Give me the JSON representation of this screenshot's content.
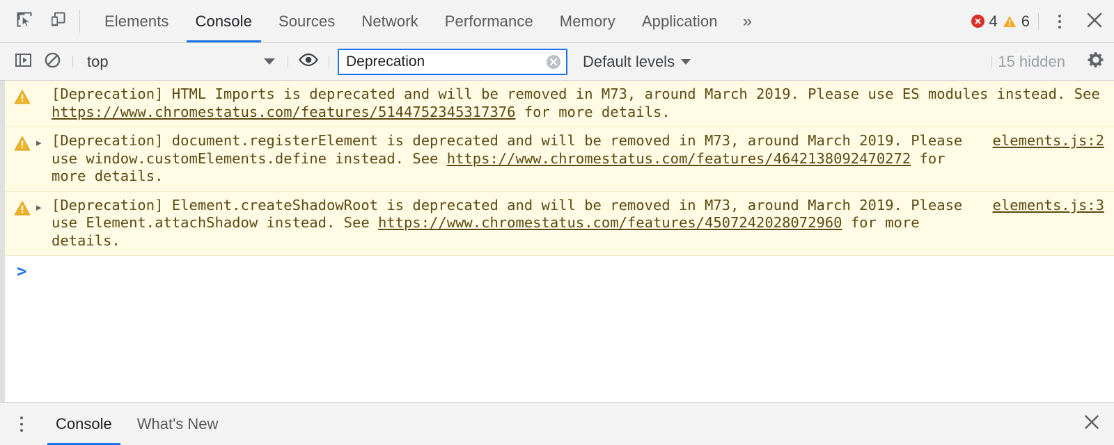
{
  "toolbar": {
    "inspect_icon": "inspect-element-icon",
    "device_icon": "device-toolbar-icon",
    "tabs": [
      {
        "label": "Elements",
        "selected": false
      },
      {
        "label": "Console",
        "selected": true
      },
      {
        "label": "Sources",
        "selected": false
      },
      {
        "label": "Network",
        "selected": false
      },
      {
        "label": "Performance",
        "selected": false
      },
      {
        "label": "Memory",
        "selected": false
      },
      {
        "label": "Application",
        "selected": false
      }
    ],
    "more_tabs_label": "»",
    "error_count": "4",
    "warning_count": "6",
    "error_color": "#d93025",
    "warning_color": "#f9a825",
    "accent_color": "#1a73e8",
    "menu_icon": "kebab-menu-icon",
    "close_icon": "close-icon"
  },
  "filterbar": {
    "sidebar_toggle_icon": "console-sidebar-icon",
    "clear_console_icon": "clear-console-icon",
    "context_selected": "top",
    "eye_icon": "live-expression-icon",
    "filter_value": "Deprecation",
    "filter_placeholder": "Filter",
    "clear_filter_icon": "clear-input-icon",
    "levels_label": "Default levels",
    "hidden_label": "15 hidden",
    "settings_icon": "gear-icon"
  },
  "console": {
    "prompt_symbol": ">",
    "prompt_value": "",
    "messages": [
      {
        "level": "warning",
        "icon": "warning-icon",
        "expandable": false,
        "source": "",
        "parts": [
          {
            "t": "[Deprecation] HTML Imports is deprecated and will be removed in M73, around March 2019. Please use ES modules instead. See ",
            "link": false
          },
          {
            "t": "https://www.chromestatus.com/features/5144752345317376",
            "link": true
          },
          {
            "t": " for more details.",
            "link": false
          }
        ]
      },
      {
        "level": "warning",
        "icon": "warning-icon",
        "expandable": true,
        "source": "elements.js:2",
        "parts": [
          {
            "t": "[Deprecation] document.registerElement is deprecated and will be removed in M73, around March 2019. Please use window.customElements.define instead. See ",
            "link": false
          },
          {
            "t": "https://www.chromestatus.com/features/4642138092470272",
            "link": true
          },
          {
            "t": " for more details.",
            "link": false
          }
        ]
      },
      {
        "level": "warning",
        "icon": "warning-icon",
        "expandable": true,
        "source": "elements.js:3",
        "parts": [
          {
            "t": "[Deprecation] Element.createShadowRoot is deprecated and will be removed in M73, around March 2019. Please use Element.attachShadow instead. See ",
            "link": false
          },
          {
            "t": "https://www.chromestatus.com/features/4507242028072960",
            "link": true
          },
          {
            "t": " for more details.",
            "link": false
          }
        ]
      }
    ]
  },
  "drawer": {
    "menu_icon": "drawer-kebab-menu-icon",
    "tabs": [
      {
        "label": "Console",
        "selected": true
      },
      {
        "label": "What's New",
        "selected": false
      }
    ],
    "close_icon": "close-drawer-icon"
  }
}
